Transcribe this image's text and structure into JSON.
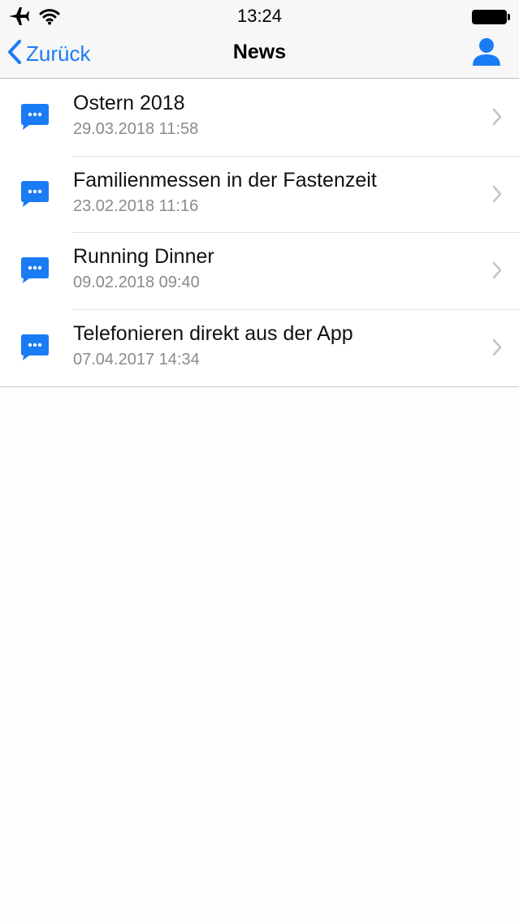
{
  "status_bar": {
    "time": "13:24"
  },
  "nav": {
    "back_label": "Zurück",
    "title": "News"
  },
  "colors": {
    "accent": "#1a7cf4",
    "date_text": "#8a8a8f"
  },
  "news": [
    {
      "title": "Ostern 2018",
      "date": "29.03.2018 11:58"
    },
    {
      "title": "Familienmessen in der Fastenzeit",
      "date": "23.02.2018 11:16"
    },
    {
      "title": "Running Dinner",
      "date": "09.02.2018 09:40"
    },
    {
      "title": "Telefonieren direkt aus der App",
      "date": "07.04.2017 14:34"
    }
  ]
}
